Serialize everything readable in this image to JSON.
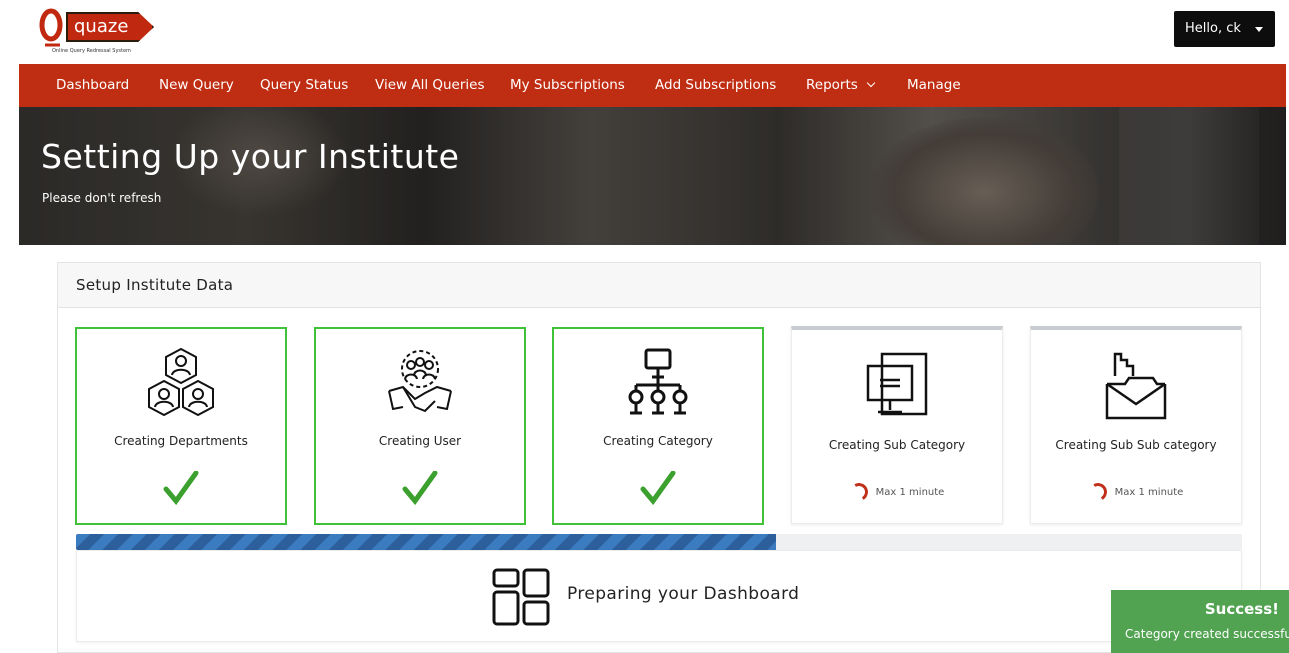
{
  "brand": {
    "name": "quaze",
    "tagline": "Online Query Redressal System",
    "color": "#c0280f"
  },
  "user_menu": {
    "label": "Hello, ck"
  },
  "nav": {
    "color": "#bf2d12",
    "items": [
      {
        "label": "Dashboard"
      },
      {
        "label": "New Query"
      },
      {
        "label": "Query Status"
      },
      {
        "label": "View All Queries"
      },
      {
        "label": "My Subscriptions"
      },
      {
        "label": "Add Subscriptions"
      },
      {
        "label": "Reports",
        "has_dropdown": true
      },
      {
        "label": "Manage"
      }
    ]
  },
  "hero": {
    "title": "Setting Up your Institute",
    "subtitle": "Please don't refresh"
  },
  "setup": {
    "header": "Setup Institute Data",
    "steps": [
      {
        "label": "Creating Departments",
        "status": "done",
        "icon": "departments-icon"
      },
      {
        "label": "Creating User",
        "status": "done",
        "icon": "users-handshake-icon"
      },
      {
        "label": "Creating Category",
        "status": "done",
        "icon": "hierarchy-icon"
      },
      {
        "label": "Creating Sub Category",
        "status": "pending",
        "icon": "document-screen-icon",
        "wait_text": "Max 1 minute"
      },
      {
        "label": "Creating Sub Sub category",
        "status": "pending",
        "icon": "folder-envelope-icon",
        "wait_text": "Max 1 minute"
      }
    ],
    "success_color": "#40c13a",
    "spinner_color": "#c0301a"
  },
  "progress": {
    "fraction": 0.6,
    "color": "#3b7bbf"
  },
  "prepare": {
    "text": "Preparing your Dashboard",
    "icon": "dashboard-grid-icon"
  },
  "toast": {
    "title": "Success!",
    "message": "Category created successfully",
    "color": "#51a351"
  }
}
